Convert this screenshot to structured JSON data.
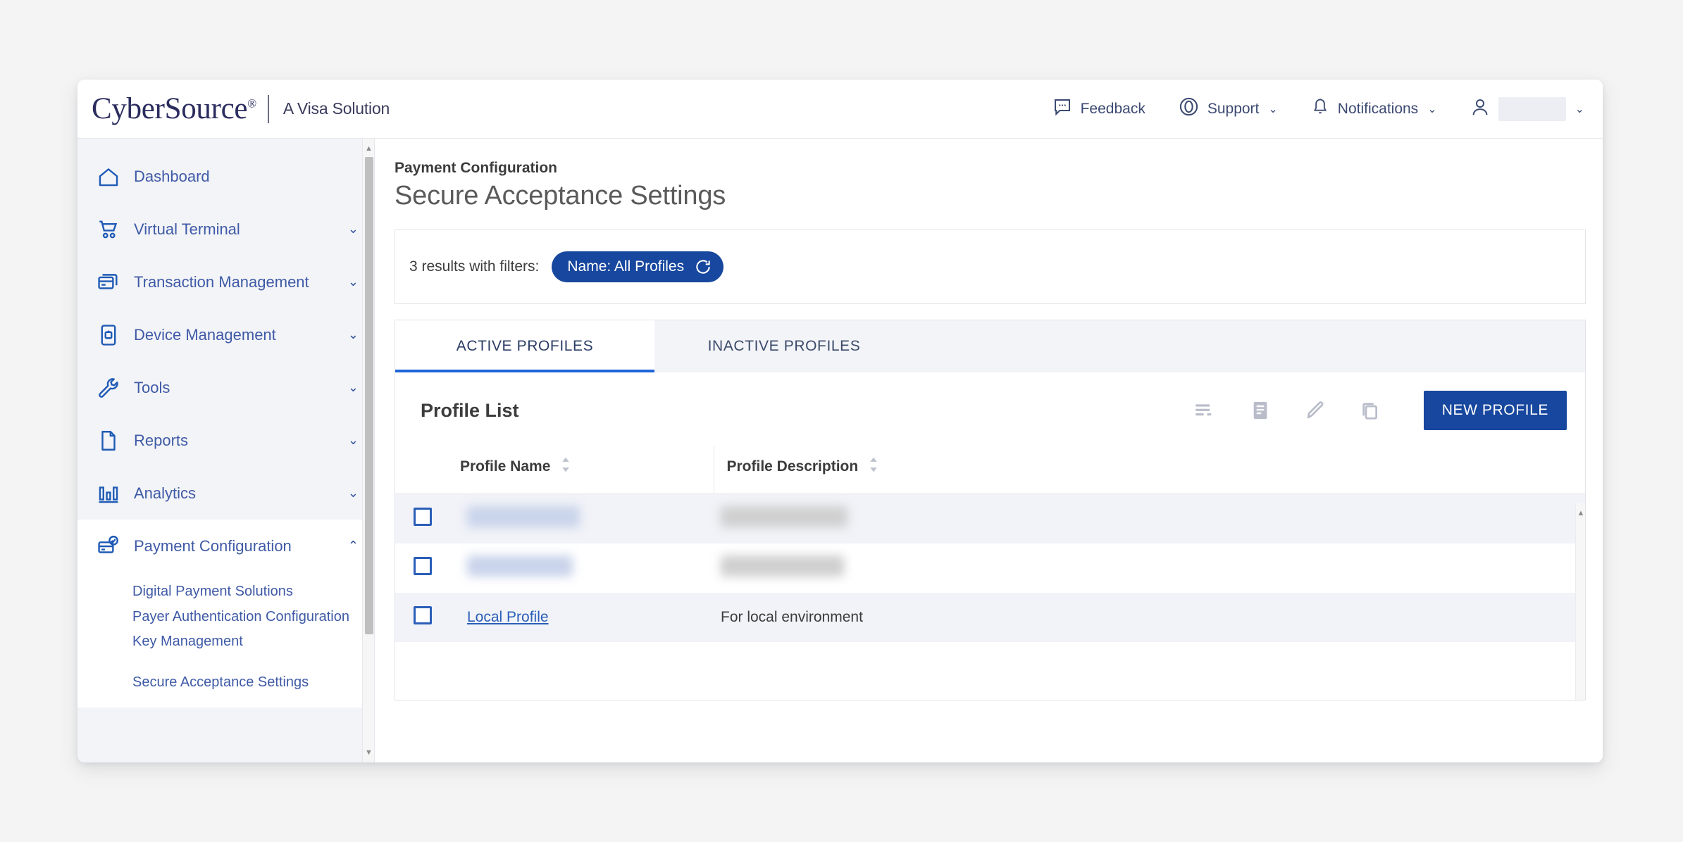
{
  "brand": {
    "name": "CyberSource",
    "registered": "®",
    "tagline": "A Visa Solution"
  },
  "topbar": {
    "feedback": "Feedback",
    "support": "Support",
    "notifications": "Notifications",
    "chevron": "⌄",
    "user_name_redacted": ""
  },
  "sidebar": {
    "items": [
      {
        "label": "Dashboard",
        "icon": "home-icon",
        "expandable": false
      },
      {
        "label": "Virtual Terminal",
        "icon": "cart-icon",
        "expandable": true,
        "chevron": "⌄"
      },
      {
        "label": "Transaction Management",
        "icon": "cards-icon",
        "expandable": true,
        "chevron": "⌄"
      },
      {
        "label": "Device Management",
        "icon": "device-icon",
        "expandable": true,
        "chevron": "⌄"
      },
      {
        "label": "Tools",
        "icon": "wrench-icon",
        "expandable": true,
        "chevron": "⌄"
      },
      {
        "label": "Reports",
        "icon": "document-icon",
        "expandable": true,
        "chevron": "⌄"
      },
      {
        "label": "Analytics",
        "icon": "bar-chart-icon",
        "expandable": true,
        "chevron": "⌄"
      },
      {
        "label": "Payment Configuration",
        "icon": "payment-config-icon",
        "expandable": true,
        "chevron": "⌃",
        "expanded": true
      }
    ],
    "payment_configuration_subitems": [
      "Digital Payment Solutions",
      "Payer Authentication Configuration",
      "Key Management",
      "Secure Acceptance Settings"
    ]
  },
  "main": {
    "breadcrumb": "Payment Configuration",
    "page_title": "Secure Acceptance Settings",
    "filters": {
      "results_text": "3 results with filters:",
      "chip_label": "Name: All Profiles",
      "chip_icon": "reset-circle-icon"
    },
    "tabs": [
      {
        "label": "ACTIVE PROFILES",
        "active": true
      },
      {
        "label": "INACTIVE PROFILES",
        "active": false
      }
    ],
    "list": {
      "title": "Profile List",
      "tools": [
        {
          "name": "sort-lines-icon"
        },
        {
          "name": "document-lines-icon"
        },
        {
          "name": "pencil-edit-icon"
        },
        {
          "name": "copy-duplicate-icon"
        }
      ],
      "new_profile_label": "NEW PROFILE",
      "columns": [
        {
          "label": "Profile Name",
          "sortable": true
        },
        {
          "label": "Profile Description",
          "sortable": true
        }
      ],
      "rows": [
        {
          "name": "",
          "description": "",
          "redacted": true
        },
        {
          "name": "",
          "description": "",
          "redacted": true
        },
        {
          "name": "Local Profile",
          "description": "For local environment",
          "redacted": false
        }
      ]
    }
  },
  "colors": {
    "brand_navy": "#2b2c5e",
    "accent_blue": "#17479e",
    "link_blue": "#2b5eb8",
    "nav_text": "#3f5aa6",
    "tab_underline": "#1d64d8",
    "row_stripe": "#f1f3f8",
    "sidebar_bg": "#f3f4f8",
    "page_bg": "#f4f4f4"
  }
}
